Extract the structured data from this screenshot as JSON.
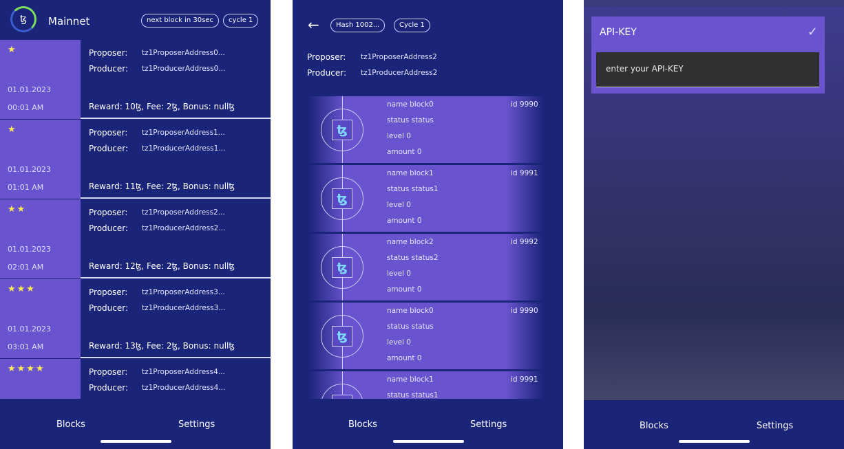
{
  "screen1": {
    "network_title": "Mainnet",
    "logo_icon": "tezos-logo-icon",
    "next_block_pill": "next block in 30sec",
    "cycle_pill": "cycle 1",
    "rows": [
      {
        "stars": "★",
        "date": "01.01.2023",
        "time": "00:01 AM",
        "proposer_label": "Proposer:",
        "proposer": "tz1ProposerAddress0...",
        "producer_label": "Producer:",
        "producer": "tz1ProducerAddress0...",
        "reward": "Reward: 10ꜩ, Fee: 2ꜩ, Bonus: nullꜩ"
      },
      {
        "stars": "★",
        "date": "01.01.2023",
        "time": "01:01 AM",
        "proposer_label": "Proposer:",
        "proposer": "tz1ProposerAddress1...",
        "producer_label": "Producer:",
        "producer": "tz1ProducerAddress1...",
        "reward": "Reward: 11ꜩ, Fee: 2ꜩ, Bonus: nullꜩ"
      },
      {
        "stars": "★★",
        "date": "01.01.2023",
        "time": "02:01 AM",
        "proposer_label": "Proposer:",
        "proposer": "tz1ProposerAddress2...",
        "producer_label": "Producer:",
        "producer": "tz1ProducerAddress2...",
        "reward": "Reward: 12ꜩ, Fee: 2ꜩ, Bonus: nullꜩ"
      },
      {
        "stars": "★★★",
        "date": "01.01.2023",
        "time": "03:01 AM",
        "proposer_label": "Proposer:",
        "proposer": "tz1ProposerAddress3...",
        "producer_label": "Producer:",
        "producer": "tz1ProducerAddress3...",
        "reward": "Reward: 13ꜩ, Fee: 2ꜩ, Bonus: nullꜩ"
      },
      {
        "stars": "★★★★",
        "date": "",
        "time": "",
        "proposer_label": "Proposer:",
        "proposer": "tz1ProposerAddress4...",
        "producer_label": "Producer:",
        "producer": "tz1ProducerAddress4...",
        "reward": ""
      }
    ],
    "nav": {
      "blocks": "Blocks",
      "settings": "Settings"
    }
  },
  "screen2": {
    "back_icon": "arrow-left-icon",
    "hash_pill": "Hash 1002...",
    "cycle_pill": "Cycle 1",
    "proposer_label": "Proposer:",
    "proposer": "tz1ProposerAddress2",
    "producer_label": "Producer:",
    "producer": "tz1ProducerAddress2",
    "blocks": [
      {
        "name": "name block0",
        "id": "id 9990",
        "status": "status status",
        "level": "level 0",
        "amount": "amount 0"
      },
      {
        "name": "name block1",
        "id": "id 9991",
        "status": "status status1",
        "level": "level 0",
        "amount": "amount 0"
      },
      {
        "name": "name block2",
        "id": "id 9992",
        "status": "status status2",
        "level": "level 0",
        "amount": "amount 0"
      },
      {
        "name": "name block0",
        "id": "id 9990",
        "status": "status status",
        "level": "level 0",
        "amount": "amount 0"
      },
      {
        "name": "name block1",
        "id": "id 9991",
        "status": "status status1",
        "level": "",
        "amount": ""
      }
    ],
    "nav": {
      "blocks": "Blocks",
      "settings": "Settings"
    }
  },
  "screen3": {
    "title": "API-KEY",
    "confirm_icon": "checkmark-icon",
    "input_placeholder": "enter your API-KEY",
    "nav": {
      "blocks": "Blocks",
      "settings": "Settings"
    }
  }
}
